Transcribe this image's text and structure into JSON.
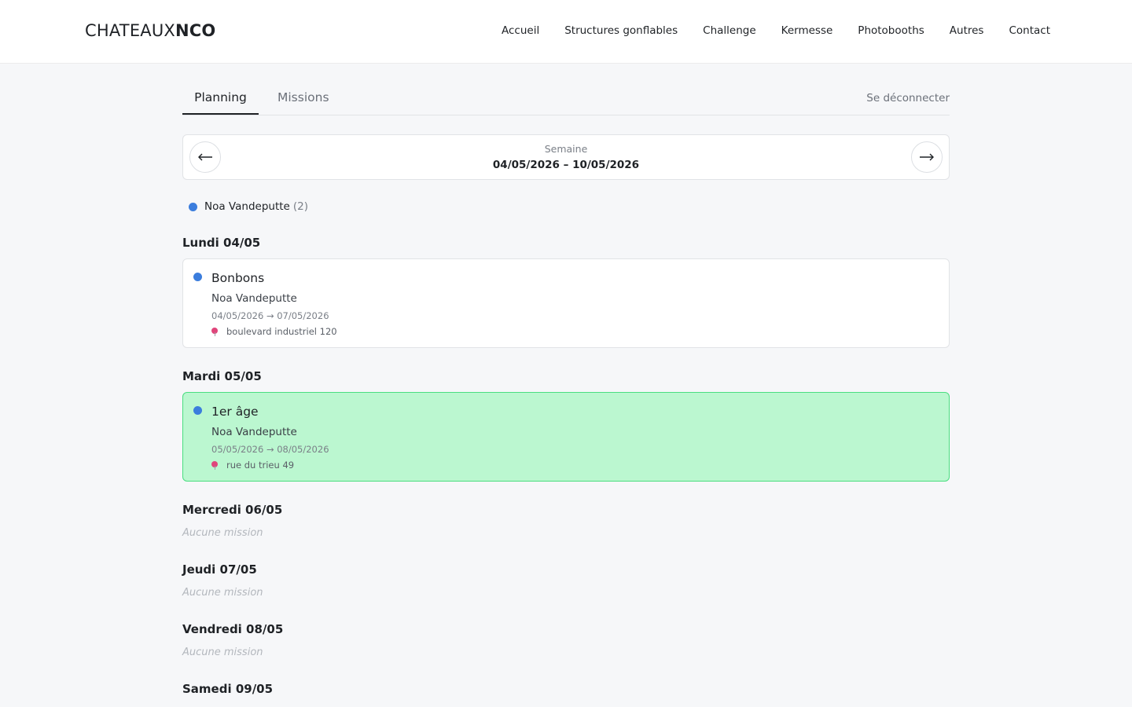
{
  "header": {
    "logo_thin": "CHATEAUX",
    "logo_bold": "NCO",
    "nav": [
      "Accueil",
      "Structures gonflables",
      "Challenge",
      "Kermesse",
      "Photobooths",
      "Autres",
      "Contact"
    ]
  },
  "tabs": {
    "planning": "Planning",
    "missions": "Missions",
    "logout": "Se déconnecter"
  },
  "week": {
    "label": "Semaine",
    "range": "04/05/2026 – 10/05/2026",
    "prev_icon": "arrow-left-icon",
    "next_icon": "arrow-right-icon"
  },
  "legend": {
    "name": "Noa Vandeputte",
    "count": "(2)",
    "color": "#3b7ddd"
  },
  "days": [
    {
      "title": "Lundi 04/05",
      "missions": [
        {
          "title": "Bonbons",
          "person": "Noa Vandeputte",
          "dates": "04/05/2026 → 07/05/2026",
          "address": "boulevard industriel 120",
          "highlight": false
        }
      ]
    },
    {
      "title": "Mardi 05/05",
      "missions": [
        {
          "title": "1er âge",
          "person": "Noa Vandeputte",
          "dates": "05/05/2026 → 08/05/2026",
          "address": "rue du trieu 49",
          "highlight": true
        }
      ]
    },
    {
      "title": "Mercredi 06/05",
      "empty": "Aucune mission"
    },
    {
      "title": "Jeudi 07/05",
      "empty": "Aucune mission"
    },
    {
      "title": "Vendredi 08/05",
      "empty": "Aucune mission"
    },
    {
      "title": "Samedi 09/05"
    }
  ],
  "colors": {
    "accent": "#3b7ddd",
    "highlight_bg": "#bbf7d0",
    "highlight_border": "#4ade80",
    "pin": "#e0457b"
  }
}
